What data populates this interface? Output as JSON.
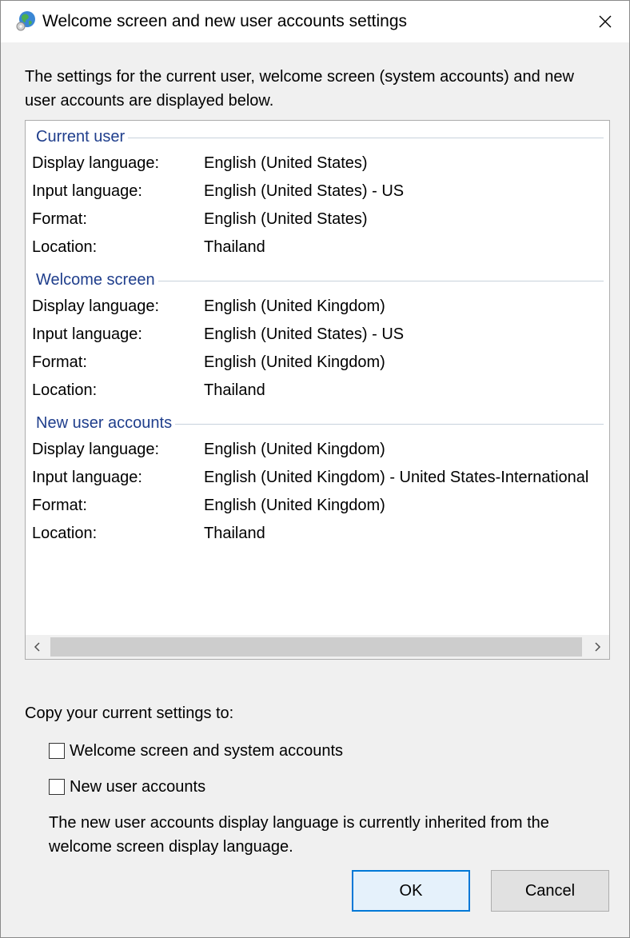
{
  "window": {
    "title": "Welcome screen and new user accounts settings",
    "icon": "globe-icon"
  },
  "intro": "The settings for the current user, welcome screen (system accounts) and new user accounts are displayed below.",
  "sections": [
    {
      "heading": "Current user",
      "rows": [
        {
          "label": "Display language:",
          "value": "English (United States)"
        },
        {
          "label": "Input language:",
          "value": "English (United States) - US"
        },
        {
          "label": "Format:",
          "value": "English (United States)"
        },
        {
          "label": "Location:",
          "value": "Thailand"
        }
      ]
    },
    {
      "heading": "Welcome screen",
      "rows": [
        {
          "label": "Display language:",
          "value": "English (United Kingdom)"
        },
        {
          "label": "Input language:",
          "value": "English (United States) - US"
        },
        {
          "label": "Format:",
          "value": "English (United Kingdom)"
        },
        {
          "label": "Location:",
          "value": "Thailand"
        }
      ]
    },
    {
      "heading": "New user accounts",
      "rows": [
        {
          "label": "Display language:",
          "value": "English (United Kingdom)"
        },
        {
          "label": "Input language:",
          "value": "English (United Kingdom) - United States-International"
        },
        {
          "label": "Format:",
          "value": "English (United Kingdom)"
        },
        {
          "label": "Location:",
          "value": "Thailand"
        }
      ]
    }
  ],
  "copy": {
    "label": "Copy your current settings to:",
    "options": [
      {
        "label": "Welcome screen and system accounts",
        "checked": false
      },
      {
        "label": "New user accounts",
        "checked": false
      }
    ],
    "note": "The new user accounts display language is currently inherited from the welcome screen display language."
  },
  "buttons": {
    "ok": "OK",
    "cancel": "Cancel"
  },
  "colors": {
    "section_heading": "#1f3e8c",
    "ok_border": "#0078d7"
  }
}
